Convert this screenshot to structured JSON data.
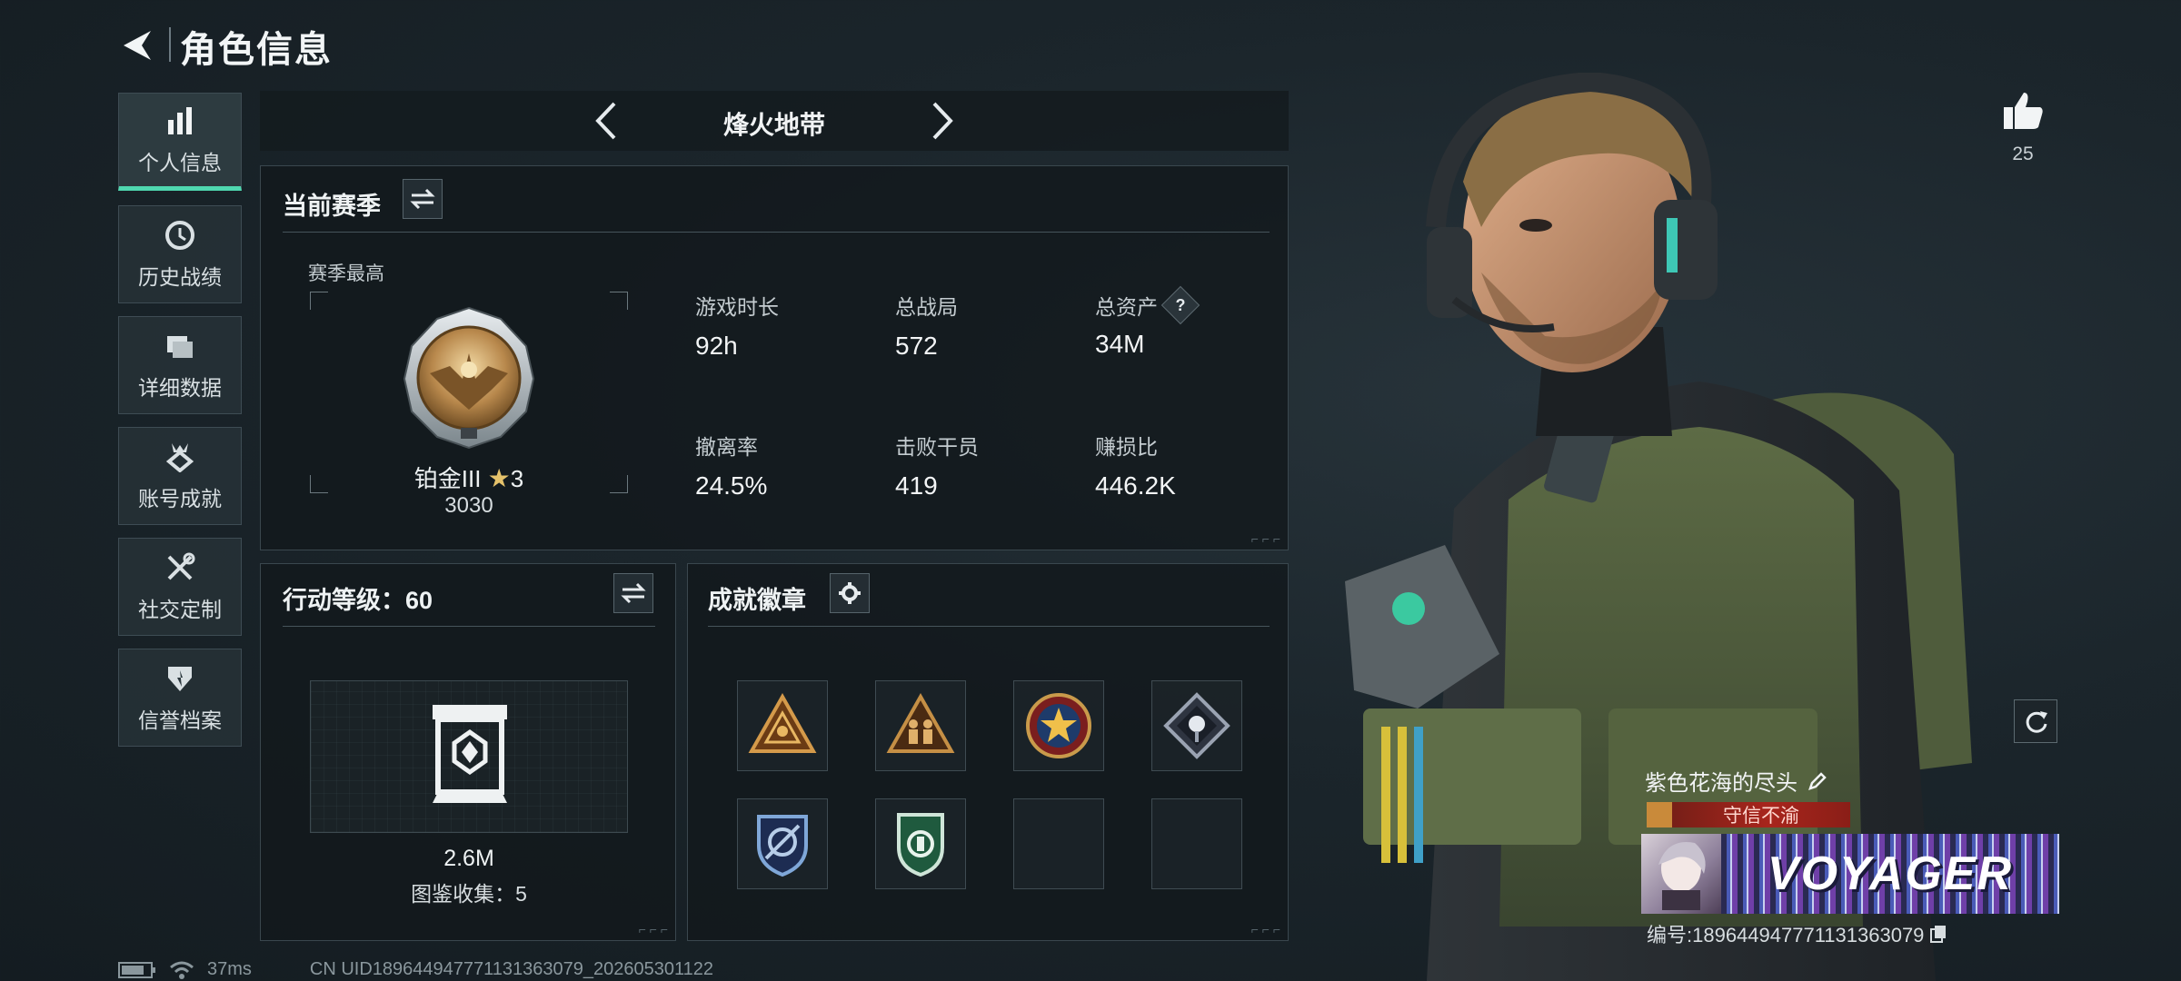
{
  "header": {
    "title": "角色信息"
  },
  "sidebar": {
    "items": [
      {
        "label": "个人信息",
        "icon": "bar-chart-icon",
        "active": true
      },
      {
        "label": "历史战绩",
        "icon": "clock-icon",
        "active": false
      },
      {
        "label": "详细数据",
        "icon": "folder-icon",
        "active": false
      },
      {
        "label": "账号成就",
        "icon": "medal-icon",
        "active": false
      },
      {
        "label": "社交定制",
        "icon": "tools-icon",
        "active": false
      },
      {
        "label": "信誉档案",
        "icon": "shield-icon",
        "active": false
      }
    ]
  },
  "mode": {
    "title": "烽火地带"
  },
  "season": {
    "title": "当前赛季",
    "best_label": "赛季最高",
    "rank_name": "铂金III",
    "rank_stars": "3",
    "rank_points": "3030",
    "stats": [
      {
        "label": "游戏时长",
        "value": "92h"
      },
      {
        "label": "总战局",
        "value": "572"
      },
      {
        "label": "总资产",
        "value": "34M",
        "help": "?"
      },
      {
        "label": "撤离率",
        "value": "24.5%"
      },
      {
        "label": "击败干员",
        "value": "419"
      },
      {
        "label": "赚损比",
        "value": "446.2K"
      }
    ]
  },
  "action_level": {
    "title": "行动等级：60",
    "value": "2.6M",
    "collection": "图鉴收集：5"
  },
  "badges": {
    "title": "成就徽章",
    "slots": [
      {
        "icon": "triangle-eye-badge-icon",
        "filled": true
      },
      {
        "icon": "soldiers-triangle-badge-icon",
        "filled": true
      },
      {
        "icon": "star-round-badge-icon",
        "filled": true
      },
      {
        "icon": "diamond-flower-badge-icon",
        "filled": true
      },
      {
        "icon": "blue-shield-badge-icon",
        "filled": true
      },
      {
        "icon": "green-shield-badge-icon",
        "filled": true
      },
      {
        "icon": "empty-slot",
        "filled": false
      },
      {
        "icon": "empty-slot",
        "filled": false
      }
    ]
  },
  "profile": {
    "likes": "25",
    "name": "紫色花海的尽头",
    "honor_title": "守信不渝",
    "banner_text": "VOYAGER",
    "id_line": "编号:18964494777113136307​9"
  },
  "status": {
    "ping": "37ms",
    "uid": "CN UID18964494777113136307​9_202605301122"
  },
  "colors": {
    "accent": "#4fd8b0",
    "gold": "#c9a46a",
    "title_red": "#a8251c"
  }
}
